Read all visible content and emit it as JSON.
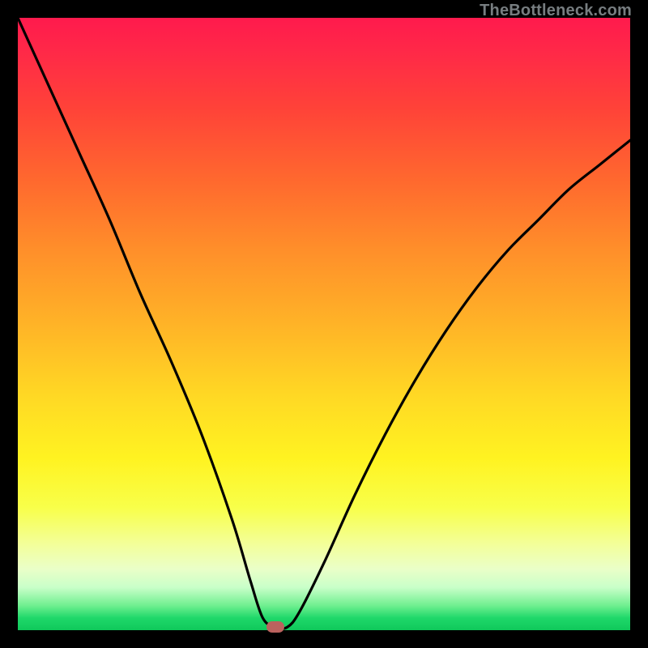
{
  "watermark": "TheBottleneck.com",
  "chart_data": {
    "type": "line",
    "title": "",
    "xlabel": "",
    "ylabel": "",
    "xlim": [
      0,
      100
    ],
    "ylim": [
      0,
      100
    ],
    "series": [
      {
        "name": "bottleneck-curve",
        "x": [
          0,
          5,
          10,
          15,
          20,
          25,
          30,
          35,
          38,
          40,
          42,
          44,
          46,
          50,
          55,
          60,
          65,
          70,
          75,
          80,
          85,
          90,
          95,
          100
        ],
        "values": [
          100,
          89,
          78,
          67,
          55,
          44,
          32,
          18,
          8,
          2,
          0.5,
          0.5,
          3,
          11,
          22,
          32,
          41,
          49,
          56,
          62,
          67,
          72,
          76,
          80
        ]
      }
    ],
    "marker": {
      "x": 42,
      "y": 0.5
    },
    "gradient_stops": [
      {
        "pos": 0,
        "color": "#ff1a4d"
      },
      {
        "pos": 50,
        "color": "#ffd924"
      },
      {
        "pos": 90,
        "color": "#eaffc8"
      },
      {
        "pos": 100,
        "color": "#0fc85a"
      }
    ]
  }
}
